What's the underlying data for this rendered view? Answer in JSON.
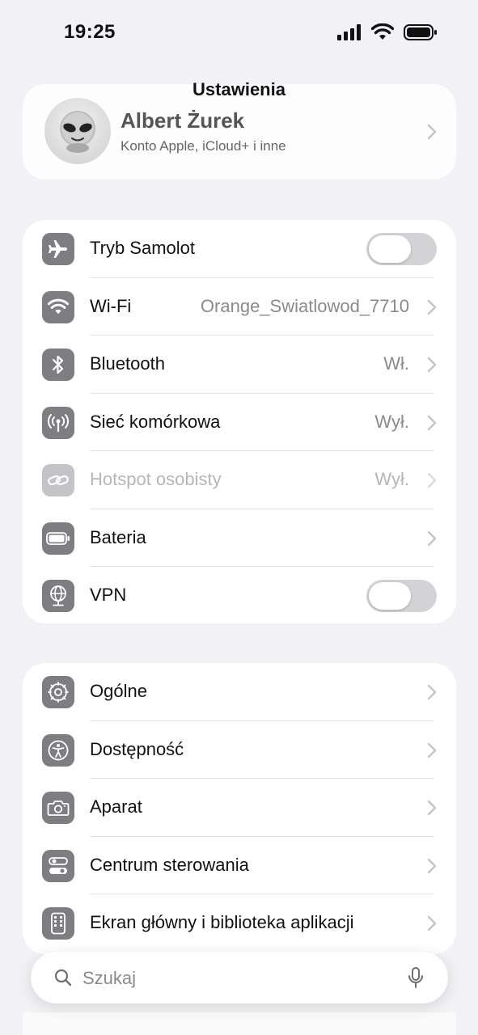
{
  "status_bar": {
    "time": "19:25"
  },
  "header": {
    "title": "Ustawienia"
  },
  "profile": {
    "name": "Albert Żurek",
    "subtitle": "Konto Apple, iCloud+ i inne"
  },
  "group1": [
    {
      "label": "Tryb Samolot",
      "icon": "airplane-icon",
      "control": "toggle",
      "on": false
    },
    {
      "label": "Wi-Fi",
      "icon": "wifi-icon",
      "value": "Orange_Swiatlowod_7710"
    },
    {
      "label": "Bluetooth",
      "icon": "bluetooth-icon",
      "value": "Wł."
    },
    {
      "label": "Sieć komórkowa",
      "icon": "cellular-icon",
      "value": "Wył."
    },
    {
      "label": "Hotspot osobisty",
      "icon": "hotspot-icon",
      "value": "Wył.",
      "disabled": true
    },
    {
      "label": "Bateria",
      "icon": "battery-icon"
    },
    {
      "label": "VPN",
      "icon": "vpn-globe-icon",
      "control": "toggle",
      "on": false
    }
  ],
  "group2": [
    {
      "label": "Ogólne",
      "icon": "gear-icon"
    },
    {
      "label": "Dostępność",
      "icon": "accessibility-icon"
    },
    {
      "label": "Aparat",
      "icon": "camera-icon"
    },
    {
      "label": "Centrum sterowania",
      "icon": "control-center-icon"
    },
    {
      "label": "Ekran główny i biblioteka aplikacji",
      "icon": "home-screen-icon"
    }
  ],
  "search": {
    "placeholder": "Szukaj"
  },
  "colors": {
    "icon_gray": "#7e7e82",
    "background": "#f2f2f6",
    "toggle_off": "#d3d3d7"
  }
}
